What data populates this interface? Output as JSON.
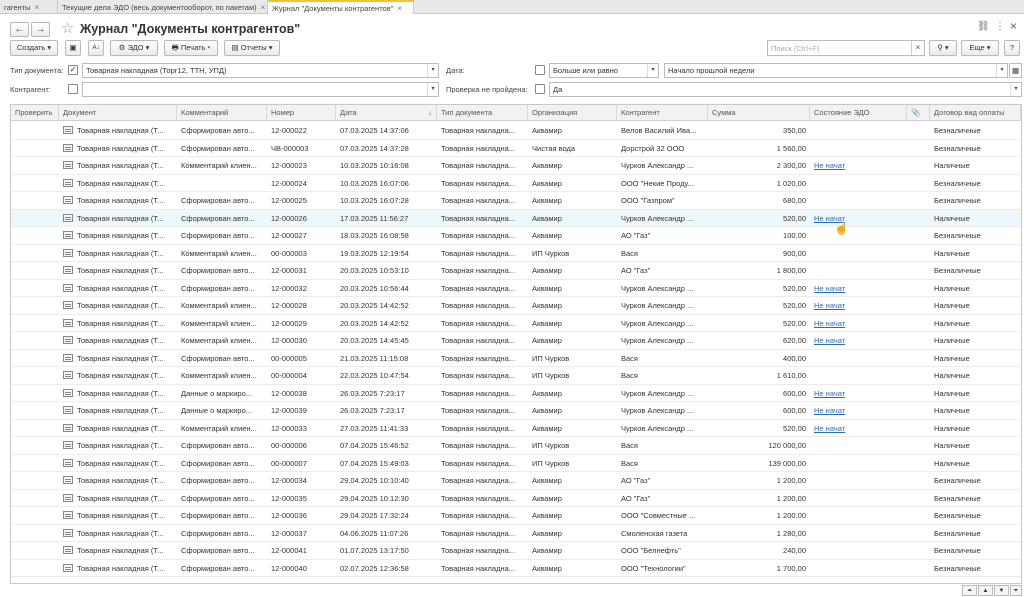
{
  "tabs": [
    {
      "label": "гагенты",
      "active": false
    },
    {
      "label": "Текущие дела ЭДО (весь документооборот, по пакетам)",
      "active": false
    },
    {
      "label": "Журнал \"Документы контрагентов\"",
      "active": true
    }
  ],
  "header": {
    "title": "Журнал \"Документы контрагентов\"",
    "back_icon": "←",
    "forward_icon": "→",
    "star_icon": "☆",
    "link_icon": "🔗",
    "more_icon": "⋮",
    "close_icon": "×"
  },
  "toolbar": {
    "create_label": "Создать",
    "edo_label": "ЭДО",
    "print_label": "Печать",
    "reports_label": "Отчеты",
    "search_placeholder": "Поиск (Ctrl+F)",
    "more_label": "Еще",
    "help_label": "?"
  },
  "filters": {
    "doc_type_label": "Тип документа:",
    "doc_type_value": "Товарная накладная (Торг12, ТТН, УПД)",
    "date_label": "Дата:",
    "date_condition": "Больше или равно",
    "date_value": "Начало прошлой недели",
    "counterparty_label": "Контрагент:",
    "counterparty_value": "",
    "check_failed_label": "Проверка не пройдена:",
    "check_failed_value": "Да"
  },
  "table": {
    "columns": [
      "Проверить",
      "Документ",
      "Комментарий",
      "Номер",
      "Дата",
      "Тип документа",
      "Организация",
      "Контрагент",
      "Сумма",
      "Состояние ЭДО",
      "📎",
      "Договор вид оплаты"
    ],
    "rows": [
      [
        "",
        "Товарная накладная (Т...",
        "Сформирован авто...",
        "12-000022",
        "07.03.2025 14:37:06",
        "Товарная накладна...",
        "Аквамир",
        "Велов Василий Ива...",
        "350,00",
        "",
        "",
        "Безналичные"
      ],
      [
        "",
        "Товарная накладная (Т...",
        "Сформирован авто...",
        "ЧВ-000003",
        "07.03.2025 14:37:28",
        "Товарная накладна...",
        "Чистая вода",
        "Дорстрой 32 ООО",
        "1 560,00",
        "",
        "",
        "Безналичные"
      ],
      [
        "",
        "Товарная накладная (Т...",
        "Комментарий клиен...",
        "12-000023",
        "10.03.2025 10:16:08",
        "Товарная накладна...",
        "Аквамир",
        "Чурков Александр ...",
        "2 300,00",
        "Не начат",
        "",
        "Наличные"
      ],
      [
        "",
        "Товарная накладная (Т...",
        "",
        "12-000024",
        "10.03.2025 16:07:06",
        "Товарная накладна...",
        "Аквамир",
        "ООО \"Некие Проду...",
        "1 020,00",
        "",
        "",
        "Безналичные"
      ],
      [
        "",
        "Товарная накладная (Т...",
        "Сформирован авто...",
        "12-000025",
        "10.03.2025 16:07:28",
        "Товарная накладна...",
        "Аквамир",
        "ООО \"Газпром\"",
        "680,00",
        "",
        "",
        "Безналичные"
      ],
      [
        "",
        "Товарная накладная (Т...",
        "Сформирован авто...",
        "12-000026",
        "17.03.2025 11:56:27",
        "Товарная накладна...",
        "Аквамир",
        "Чурков Александр ...",
        "520,00",
        "Не начат",
        "",
        "Наличные"
      ],
      [
        "",
        "Товарная накладная (Т...",
        "Сформирован авто...",
        "12-000027",
        "18.03.2025 16:08:58",
        "Товарная накладна...",
        "Аквамир",
        "АО \"Газ\"",
        "100,00",
        "",
        "",
        "Безналичные"
      ],
      [
        "",
        "Товарная накладная (Т...",
        "Комментарий клиен...",
        "00-000003",
        "19.03.2025 12:19:54",
        "Товарная накладна...",
        "ИП Чурков",
        "Вася",
        "900,00",
        "",
        "",
        "Наличные"
      ],
      [
        "",
        "Товарная накладная (Т...",
        "Сформирован авто...",
        "12-000031",
        "20.03.2025 10:53:10",
        "Товарная накладна...",
        "Аквамир",
        "АО \"Газ\"",
        "1 800,00",
        "",
        "",
        "Безналичные"
      ],
      [
        "",
        "Товарная накладная (Т...",
        "Сформирован авто...",
        "12-000032",
        "20.03.2025 10:56:44",
        "Товарная накладна...",
        "Аквамир",
        "Чурков Александр ...",
        "520,00",
        "Не начат",
        "",
        "Наличные"
      ],
      [
        "",
        "Товарная накладная (Т...",
        "Комментарий клиен...",
        "12-000028",
        "20.03.2025 14:42:52",
        "Товарная накладна...",
        "Аквамир",
        "Чурков Александр ...",
        "520,00",
        "Не начат",
        "",
        "Наличные"
      ],
      [
        "",
        "Товарная накладная (Т...",
        "Комментарий клиен...",
        "12-000029",
        "20.03.2025 14:42:52",
        "Товарная накладна...",
        "Аквамир",
        "Чурков Александр ...",
        "520,00",
        "Не начат",
        "",
        "Наличные"
      ],
      [
        "",
        "Товарная накладная (Т...",
        "Комментарий клиен...",
        "12-000030",
        "20.03.2025 14:45:45",
        "Товарная накладна...",
        "Аквамир",
        "Чурков Александр ...",
        "620,00",
        "Не начат",
        "",
        "Наличные"
      ],
      [
        "",
        "Товарная накладная (Т...",
        "Сформирован авто...",
        "00-000005",
        "21.03.2025 11:15:08",
        "Товарная накладна...",
        "ИП Чурков",
        "Вася",
        "400,00",
        "",
        "",
        "Наличные"
      ],
      [
        "",
        "Товарная накладная (Т...",
        "Комментарий клиен...",
        "00-000004",
        "22.03.2025 10:47:54",
        "Товарная накладна...",
        "ИП Чурков",
        "Вася",
        "1 610,00",
        "",
        "",
        "Наличные"
      ],
      [
        "",
        "Товарная накладная (Т...",
        "Данные о маркиро...",
        "12-000038",
        "26.03.2025 7:23:17",
        "Товарная накладна...",
        "Аквамир",
        "Чурков Александр ...",
        "600,00",
        "Не начат",
        "",
        "Наличные"
      ],
      [
        "",
        "Товарная накладная (Т...",
        "Данные о маркиро...",
        "12-000039",
        "26.03.2025 7:23:17",
        "Товарная накладна...",
        "Аквамир",
        "Чурков Александр ...",
        "600,00",
        "Не начат",
        "",
        "Наличные"
      ],
      [
        "",
        "Товарная накладная (Т...",
        "Комментарий клиен...",
        "12-000033",
        "27.03.2025 11:41:33",
        "Товарная накладна...",
        "Аквамир",
        "Чурков Александр ...",
        "520,00",
        "Не начат",
        "",
        "Наличные"
      ],
      [
        "",
        "Товарная накладная (Т...",
        "Сформирован авто...",
        "00-000006",
        "07.04.2025 15:46:52",
        "Товарная накладна...",
        "ИП Чурков",
        "Вася",
        "120 000,00",
        "",
        "",
        "Наличные"
      ],
      [
        "",
        "Товарная накладная (Т...",
        "Сформирован авто...",
        "00-000007",
        "07.04.2025 15:49:03",
        "Товарная накладна...",
        "ИП Чурков",
        "Вася",
        "139 000,00",
        "",
        "",
        "Наличные"
      ],
      [
        "",
        "Товарная накладная (Т...",
        "Сформирован авто...",
        "12-000034",
        "29.04.2025 10:10:40",
        "Товарная накладна...",
        "Аквамир",
        "АО \"Газ\"",
        "1 200,00",
        "",
        "",
        "Безналичные"
      ],
      [
        "",
        "Товарная накладная (Т...",
        "Сформирован авто...",
        "12-000035",
        "29.04.2025 10:12:30",
        "Товарная накладна...",
        "Аквамир",
        "АО \"Газ\"",
        "1 200,00",
        "",
        "",
        "Безналичные"
      ],
      [
        "",
        "Товарная накладная (Т...",
        "Сформирован авто...",
        "12-000036",
        "29.04.2025 17:32:24",
        "Товарная накладна...",
        "Аквамир",
        "ООО \"Совместные ...",
        "1 200,00",
        "",
        "",
        "Безналичные"
      ],
      [
        "",
        "Товарная накладная (Т...",
        "Сформирован авто...",
        "12-000037",
        "04.06.2025 11:07:26",
        "Товарная накладна...",
        "Аквамир",
        "Смоленская газета",
        "1 280,00",
        "",
        "",
        "Безналичные"
      ],
      [
        "",
        "Товарная накладная (Т...",
        "Сформирован авто...",
        "12-000041",
        "01.07.2025 13:17:50",
        "Товарная накладна...",
        "Аквамир",
        "ООО \"Белнефть\"",
        "240,00",
        "",
        "",
        "Безналичные"
      ],
      [
        "",
        "Товарная накладная (Т...",
        "Сформирован авто...",
        "12-000040",
        "02.07.2025 12:36:58",
        "Товарная накладна...",
        "Аквамир",
        "ООО \"Технологии\"",
        "1 700,00",
        "",
        "",
        "Безналичные"
      ]
    ],
    "selected_row": 5
  }
}
